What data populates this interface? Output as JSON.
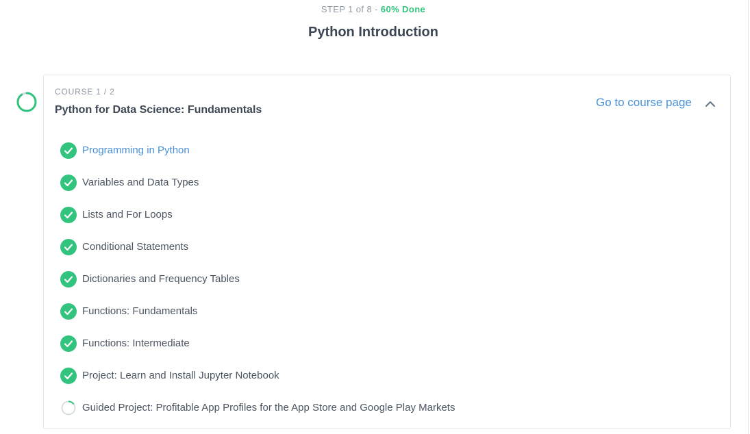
{
  "header": {
    "step_text": "STEP 1 of 8 - ",
    "progress_text": "60% Done",
    "path_title": "Python Introduction"
  },
  "course": {
    "eyebrow": "COURSE 1 / 2",
    "name": "Python for Data Science: Fundamentals",
    "link_label": "Go to course page",
    "progress_fraction": 0.9
  },
  "lessons": [
    {
      "label": "Programming in Python",
      "status": "complete",
      "active": true
    },
    {
      "label": "Variables and Data Types",
      "status": "complete",
      "active": false
    },
    {
      "label": "Lists and For Loops",
      "status": "complete",
      "active": false
    },
    {
      "label": "Conditional Statements",
      "status": "complete",
      "active": false
    },
    {
      "label": "Dictionaries and Frequency Tables",
      "status": "complete",
      "active": false
    },
    {
      "label": "Functions: Fundamentals",
      "status": "complete",
      "active": false
    },
    {
      "label": "Functions: Intermediate",
      "status": "complete",
      "active": false
    },
    {
      "label": "Project: Learn and Install Jupyter Notebook",
      "status": "complete",
      "active": false
    },
    {
      "label": "Guided Project: Profitable App Profiles for the App Store and Google Play Markets",
      "status": "in-progress",
      "active": false
    }
  ],
  "colors": {
    "accent": "#4a90d9",
    "success": "#32c47e",
    "muted": "#8e98a4",
    "ring_track": "#d7dce1"
  },
  "icons": {
    "complete": "check-circle-icon",
    "in_progress": "progress-ring-icon",
    "collapse": "chevron-up-icon",
    "course_status": "course-progress-ring-icon"
  }
}
